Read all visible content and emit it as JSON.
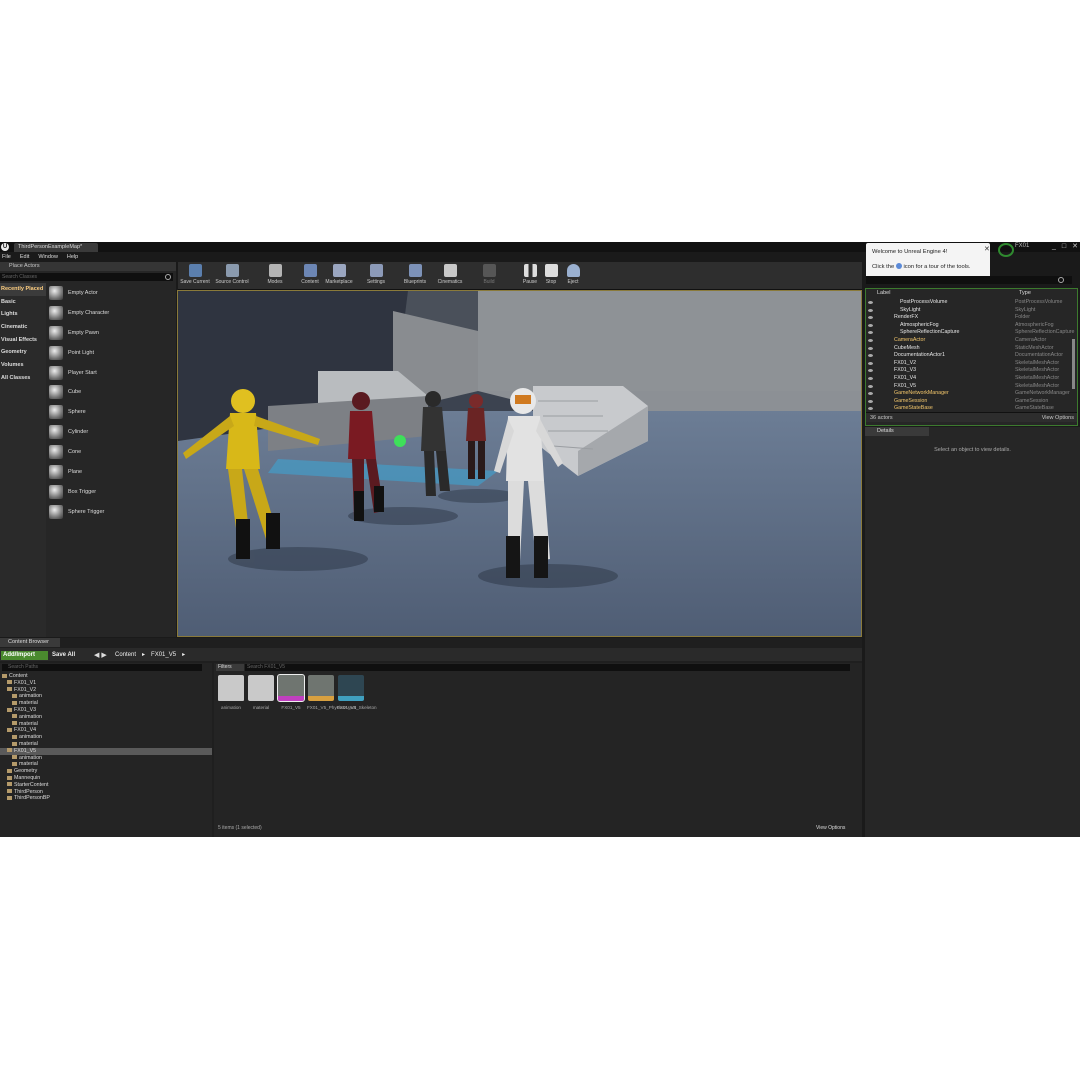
{
  "window": {
    "tab_title": "ThirdPersonExampleMap*",
    "project": "FX01",
    "controls": [
      "_",
      "□",
      "✕"
    ]
  },
  "menu": [
    "File",
    "Edit",
    "Window",
    "Help"
  ],
  "place_actors": {
    "title": "Place Actors",
    "search_placeholder": "Search Classes",
    "categories": [
      "Recently Placed",
      "Basic",
      "Lights",
      "Cinematic",
      "Visual Effects",
      "Geometry",
      "Volumes",
      "All Classes"
    ],
    "items": [
      "Empty Actor",
      "Empty Character",
      "Empty Pawn",
      "Point Light",
      "Player Start",
      "Cube",
      "Sphere",
      "Cylinder",
      "Cone",
      "Plane",
      "Box Trigger",
      "Sphere Trigger"
    ]
  },
  "toolbar": [
    {
      "label": "Save Current",
      "icon": "save-icon"
    },
    {
      "label": "Source Control",
      "icon": "source-control-icon"
    },
    {
      "label": "Modes",
      "icon": "modes-icon"
    },
    {
      "label": "Content",
      "icon": "content-icon"
    },
    {
      "label": "Marketplace",
      "icon": "marketplace-icon"
    },
    {
      "label": "Settings",
      "icon": "settings-icon"
    },
    {
      "label": "Blueprints",
      "icon": "blueprints-icon"
    },
    {
      "label": "Cinematics",
      "icon": "cinematics-icon"
    },
    {
      "label": "Build",
      "icon": "build-icon"
    },
    {
      "label": "Pause",
      "icon": "pause-icon"
    },
    {
      "label": "Stop",
      "icon": "stop-icon"
    },
    {
      "label": "Eject",
      "icon": "eject-icon"
    }
  ],
  "welcome": {
    "title": "Welcome to Unreal Engine 4!",
    "line_before": "Click the",
    "line_after": "icon for a tour of the tools."
  },
  "outliner": {
    "columns": {
      "label": "Label",
      "type": "Type"
    },
    "rows": [
      {
        "label": "PostProcessVolume",
        "type": "PostProcessVolume",
        "indent": 1
      },
      {
        "label": "SkyLight",
        "type": "SkyLight",
        "indent": 1
      },
      {
        "label": "RenderFX",
        "type": "Folder",
        "indent": 0
      },
      {
        "label": "AtmosphericFog",
        "type": "AtmosphericFog",
        "indent": 1
      },
      {
        "label": "SphereReflectionCapture",
        "type": "SphereReflectionCapture",
        "indent": 1
      },
      {
        "label": "CameraActor",
        "type": "CameraActor",
        "indent": 0,
        "yellow": true
      },
      {
        "label": "CubeMesh",
        "type": "StaticMeshActor",
        "indent": 0
      },
      {
        "label": "DocumentationActor1",
        "type": "DocumentationActor",
        "indent": 0
      },
      {
        "label": "FX01_V2",
        "type": "SkeletalMeshActor",
        "indent": 0
      },
      {
        "label": "FX01_V3",
        "type": "SkeletalMeshActor",
        "indent": 0
      },
      {
        "label": "FX01_V4",
        "type": "SkeletalMeshActor",
        "indent": 0
      },
      {
        "label": "FX01_V5",
        "type": "SkeletalMeshActor",
        "indent": 0
      },
      {
        "label": "GameNetworkManager",
        "type": "GameNetworkManager",
        "indent": 0,
        "yellow": true
      },
      {
        "label": "GameSession",
        "type": "GameSession",
        "indent": 0,
        "yellow": true
      },
      {
        "label": "GameStateBase",
        "type": "GameStateBase",
        "indent": 0,
        "yellow": true
      }
    ],
    "count": "36 actors",
    "view_options": "View Options"
  },
  "details": {
    "tab": "Details",
    "empty": "Select an object to view details."
  },
  "content_browser": {
    "tab": "Content Browser",
    "add_import": "Add/Import",
    "save_all": "Save All",
    "breadcrumb": [
      "Content",
      "FX01_V5"
    ],
    "path_search": "Search Paths",
    "filters": "Filters",
    "asset_search": "Search FX01_V5",
    "tree": [
      {
        "label": "Content",
        "indent": 0
      },
      {
        "label": "FX01_V1",
        "indent": 1
      },
      {
        "label": "FX01_V2",
        "indent": 1
      },
      {
        "label": "animation",
        "indent": 2
      },
      {
        "label": "material",
        "indent": 2
      },
      {
        "label": "FX01_V3",
        "indent": 1
      },
      {
        "label": "animation",
        "indent": 2
      },
      {
        "label": "material",
        "indent": 2
      },
      {
        "label": "FX01_V4",
        "indent": 1
      },
      {
        "label": "animation",
        "indent": 2
      },
      {
        "label": "material",
        "indent": 2
      },
      {
        "label": "FX01_V5",
        "indent": 1,
        "selected": true
      },
      {
        "label": "animation",
        "indent": 2
      },
      {
        "label": "material",
        "indent": 2
      },
      {
        "label": "Geometry",
        "indent": 1
      },
      {
        "label": "Mannequin",
        "indent": 1
      },
      {
        "label": "StarterContent",
        "indent": 1
      },
      {
        "label": "ThirdPerson",
        "indent": 1
      },
      {
        "label": "ThirdPersonBP",
        "indent": 1
      }
    ],
    "assets": [
      {
        "label": "animation",
        "kind": "folder"
      },
      {
        "label": "material",
        "kind": "folder"
      },
      {
        "label": "FX01_V5",
        "kind": "mesh",
        "selected": true
      },
      {
        "label": "FX01_V5_PhysicsAsset",
        "kind": "physics"
      },
      {
        "label": "FX01_V5_Skeleton",
        "kind": "skeleton"
      }
    ],
    "count": "5 items (1 selected)",
    "view_options": "View Options"
  }
}
